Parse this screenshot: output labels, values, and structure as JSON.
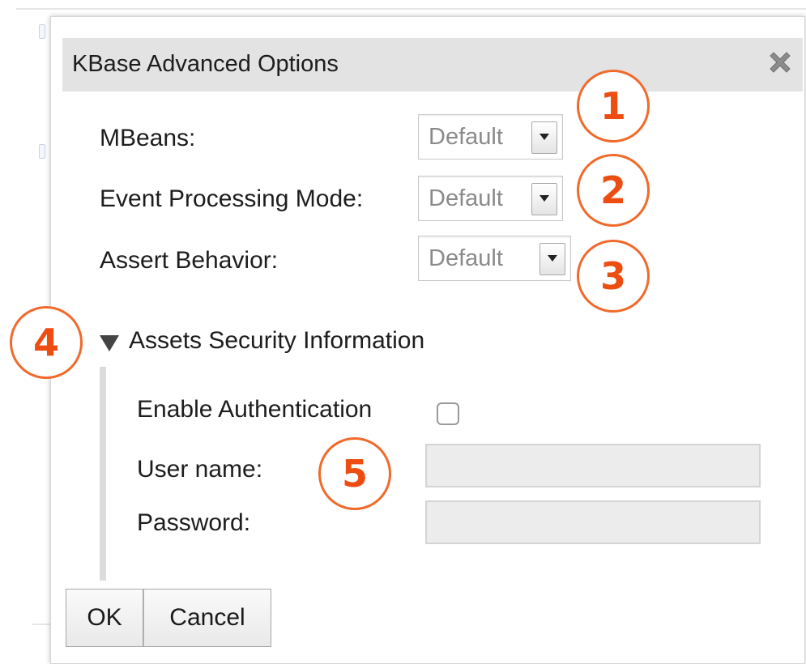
{
  "dialog": {
    "title": "KBase Advanced Options"
  },
  "fields": {
    "mbeans": {
      "label": "MBeans:",
      "value": "Default"
    },
    "event_processing": {
      "label": "Event Processing Mode:",
      "value": "Default"
    },
    "assert_behavior": {
      "label": "Assert Behavior:",
      "value": "Default"
    }
  },
  "security": {
    "header": "Assets Security Information",
    "enable_auth_label": "Enable Authentication",
    "enable_auth_checked": false,
    "username_label": "User name:",
    "username_value": "",
    "password_label": "Password:",
    "password_value": ""
  },
  "buttons": {
    "ok": "OK",
    "cancel": "Cancel"
  },
  "callouts": [
    "1",
    "2",
    "3",
    "4",
    "5"
  ],
  "colors": {
    "callout": "#ee4d12",
    "titlebar": "#e3e3e3"
  },
  "icons": {
    "close": "close-icon",
    "dropdown": "chevron-down-icon",
    "disclosure": "triangle-down-icon"
  }
}
